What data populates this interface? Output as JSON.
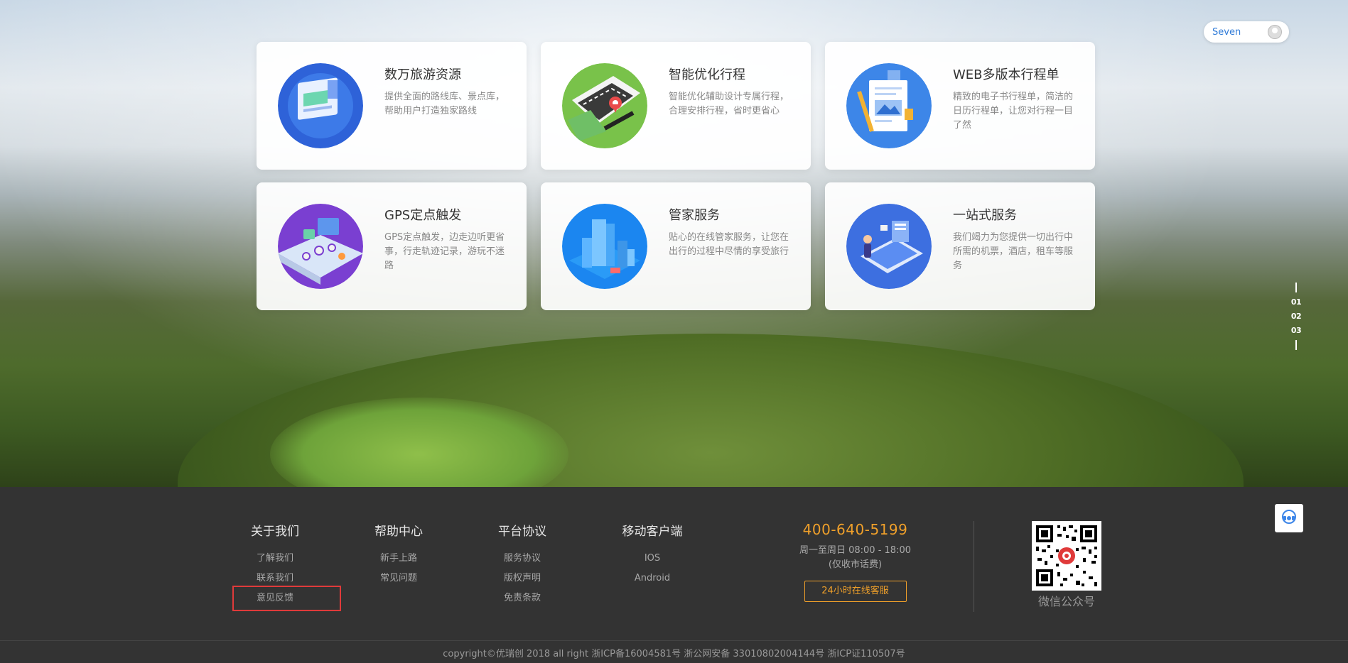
{
  "user": {
    "name": "Seven"
  },
  "features": [
    {
      "title": "数万旅游资源",
      "desc": "提供全面的路线库、景点库， 帮助用户打造独家路线",
      "icon": "resource-illustration-icon"
    },
    {
      "title": "智能优化行程",
      "desc": "智能优化辅助设计专属行程，合理安排行程，省时更省心",
      "icon": "route-map-illustration-icon"
    },
    {
      "title": "WEB多版本行程单",
      "desc": "精致的电子书行程单，简洁的日历行程单，让您对行程一目了然",
      "icon": "document-illustration-icon"
    },
    {
      "title": "GPS定点触发",
      "desc": "GPS定点触发，边走边听更省事，行走轨迹记录，游玩不迷路",
      "icon": "gps-illustration-icon"
    },
    {
      "title": "管家服务",
      "desc": "贴心的在线管家服务，让您在出行的过程中尽情的享受旅行",
      "icon": "city-illustration-icon"
    },
    {
      "title": "一站式服务",
      "desc": "我们竭力为您提供一切出行中所需的机票，酒店，租车等服务",
      "icon": "tablet-illustration-icon"
    }
  ],
  "side_nav": [
    "01",
    "02",
    "03"
  ],
  "footer": {
    "columns": [
      {
        "title": "关于我们",
        "links": [
          "了解我们",
          "联系我们",
          "意见反馈"
        ]
      },
      {
        "title": "帮助中心",
        "links": [
          "新手上路",
          "常见问题"
        ]
      },
      {
        "title": "平台协议",
        "links": [
          "服务协议",
          "版权声明",
          "免责条款"
        ]
      },
      {
        "title": "移动客户端",
        "links": [
          "IOS",
          "Android"
        ]
      }
    ],
    "phone": "400-640-5199",
    "hours_line1": "周一至周日 08:00 - 18:00",
    "hours_line2": "(仅收市话费)",
    "service_button": "24小时在线客服",
    "qr_label": "微信公众号",
    "copyright": "copyright©优瑞创 2018 all right 浙ICP备16004581号 浙公网安备 33010802004144号 浙ICP证110507号"
  },
  "colors": {
    "accent_orange": "#f0a02a",
    "link_blue": "#2f7bd8",
    "highlight_red": "#e03a3a"
  }
}
